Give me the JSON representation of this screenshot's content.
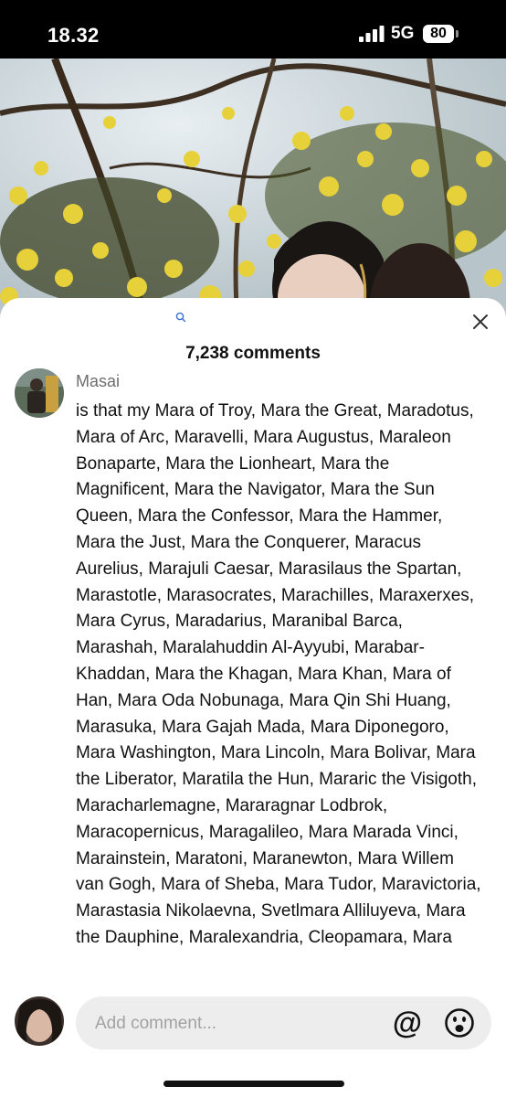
{
  "status_bar": {
    "time": "18.32",
    "network": "5G",
    "battery": "80"
  },
  "comments_sheet": {
    "title": "7,238 comments",
    "comment": {
      "author": "Masai",
      "text": "is that my Mara of Troy, Mara the Great, Maradotus, Mara of Arc, Maravelli, Mara Augustus, Maraleon Bonaparte, Mara the Lionheart, Mara the Magnificent, Mara the Navigator, Mara the Sun Queen, Mara the Confessor, Mara the Hammer, Mara the Just, Mara the Conquerer, Maracus Aurelius, Marajuli Caesar, Marasilaus the Spartan, Marastotle, Marasocrates, Marachilles, Maraxerxes, Mara Cyrus, Maradarius, Maranibal Barca, Marashah, Maralahuddin Al-Ayyubi, Marabar-Khaddan, Mara the Khagan, Mara Khan, Mara of Han, Mara Oda Nobunaga, Mara Qin Shi Huang, Marasuka, Mara Gajah Mada, Mara Diponegoro, Mara Washington, Mara Lincoln, Mara Bolivar, Mara the Liberator, Maratila the Hun, Mararic the Visigoth, Maracharlemagne, Mararagnar Lodbrok, Maracopernicus, Maragalileo, Mara Marada Vinci, Marainstein, Maratoni, Maranewton, Mara Willem van Gogh, Mara of Sheba, Mara Tudor, Maravictoria, Marastasia Nikolaevna, Svetlmara Alliluyeva, Mara the Dauphine, Maralexandria, Cleopamara, Mara"
    }
  },
  "composer": {
    "placeholder": "Add comment..."
  },
  "icons": {
    "search": "search-icon",
    "close": "close-icon",
    "mention": "at-sign-icon",
    "emoji": "emoji-icon"
  }
}
